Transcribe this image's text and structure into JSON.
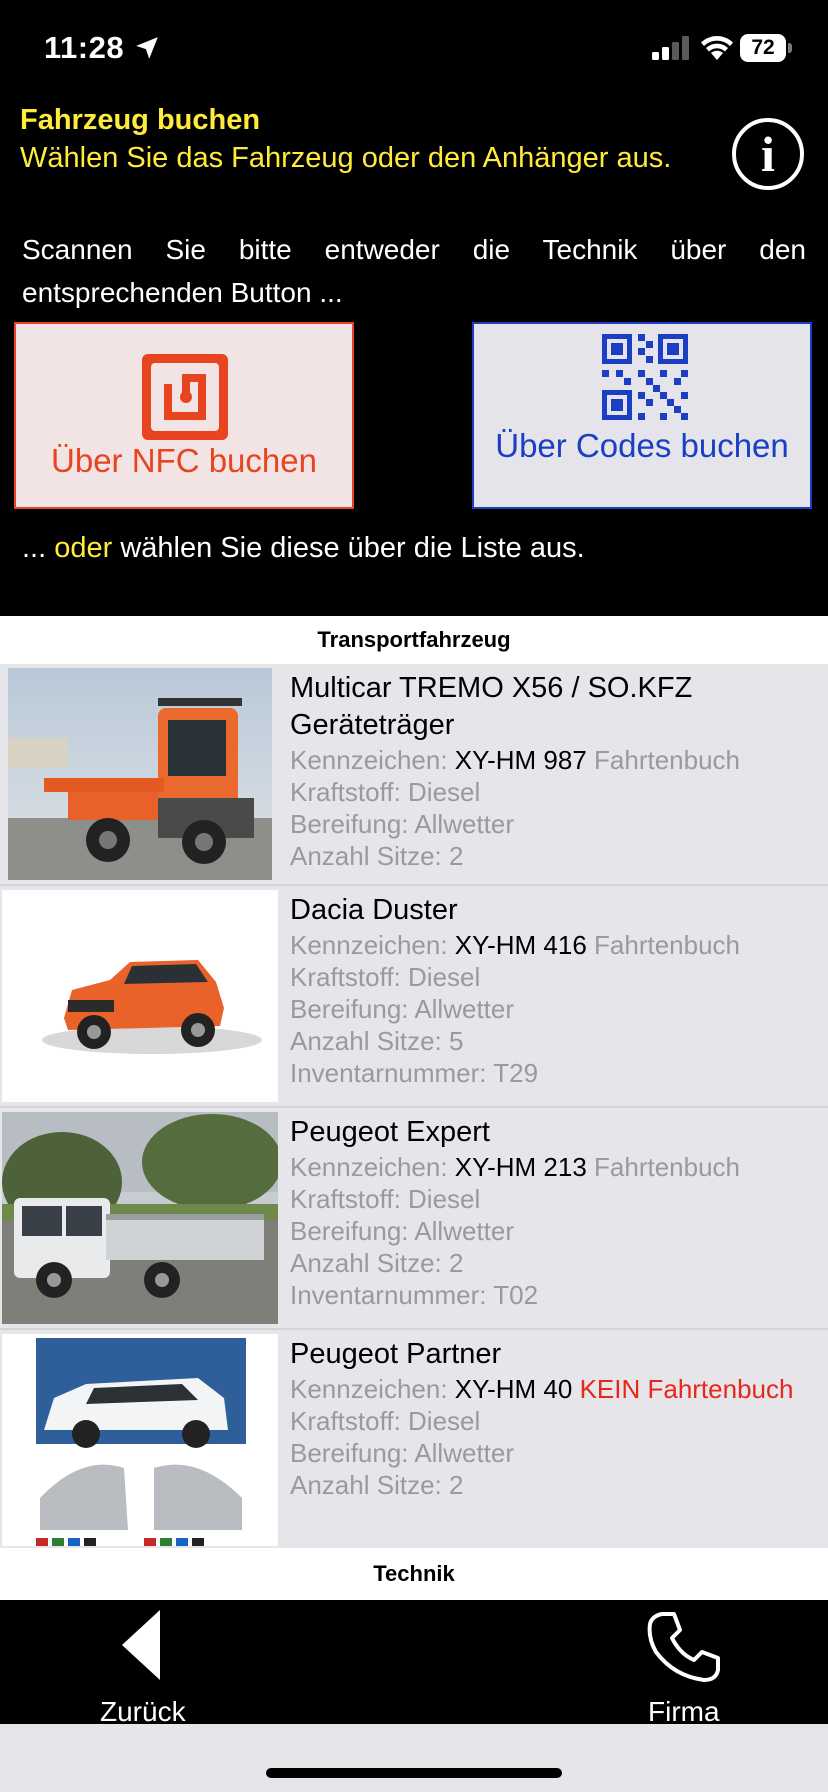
{
  "status_bar": {
    "time": "11:28",
    "battery": "72"
  },
  "header": {
    "title": "Fahrzeug buchen",
    "subtitle": "Wählen Sie das Fahrzeug oder den Anhänger aus.",
    "info_symbol": "i",
    "scan_text": "Scannen Sie bitte entweder die Technik über den entsprechenden Button ...",
    "nfc_button": "Über NFC buchen",
    "qr_button": "Über Codes buchen",
    "or_prefix": "... ",
    "or_word": "oder",
    "or_suffix": " wählen Sie diese über die Liste aus."
  },
  "sections": {
    "transport": "Transportfahrzeug",
    "technik": "Technik"
  },
  "vehicles": [
    {
      "name": "Multicar TREMO X56 / SO.KFZ Geräteträger",
      "plate_label": "Kennzeichen: ",
      "plate": "XY-HM 987",
      "logbook": " Fahrtenbuch",
      "fuel": "Kraftstoff: Diesel",
      "tires": "Bereifung: Allwetter",
      "seats": "Anzahl Sitze: 2"
    },
    {
      "name": "Dacia Duster",
      "plate_label": "Kennzeichen: ",
      "plate": "XY-HM 416",
      "logbook": " Fahrtenbuch",
      "fuel": "Kraftstoff: Diesel",
      "tires": "Bereifung: Allwetter",
      "seats": "Anzahl Sitze: 5",
      "inventory": "Inventarnummer: T29"
    },
    {
      "name": "Peugeot Expert",
      "plate_label": "Kennzeichen: ",
      "plate": "XY-HM 213",
      "logbook": " Fahrtenbuch",
      "fuel": "Kraftstoff: Diesel",
      "tires": "Bereifung: Allwetter",
      "seats": "Anzahl Sitze: 2",
      "inventory": "Inventarnummer: T02"
    },
    {
      "name": "Peugeot Partner",
      "plate_label": "Kennzeichen: ",
      "plate": "XY-HM 40",
      "logbook_warning": " KEIN Fahrtenbuch",
      "fuel": "Kraftstoff: Diesel",
      "tires": "Bereifung: Allwetter",
      "seats": "Anzahl Sitze: 2"
    }
  ],
  "bottom_bar": {
    "back": "Zurück",
    "company": "Firma"
  },
  "colors": {
    "accent_yellow": "#ffeb3b",
    "nfc_red": "#e8441f",
    "qr_blue": "#1a3fc4",
    "warning_red": "#e8261c"
  }
}
